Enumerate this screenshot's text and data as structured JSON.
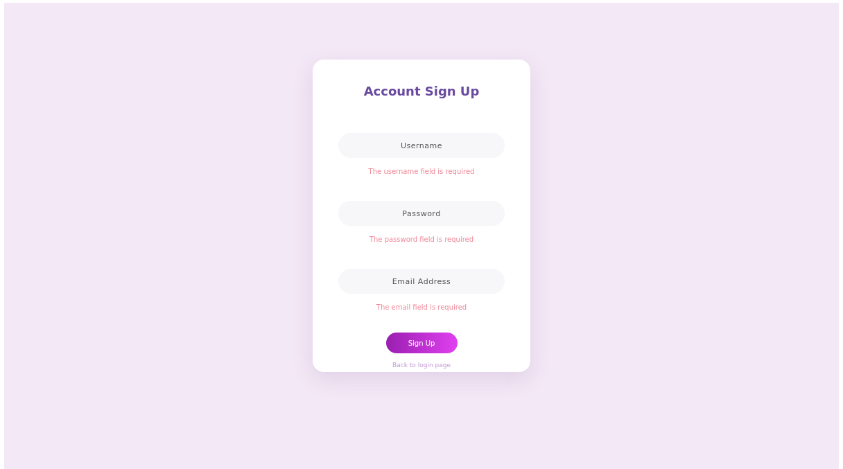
{
  "title": "Account Sign Up",
  "fields": [
    {
      "placeholder": "Username",
      "error": "The username field is required"
    },
    {
      "placeholder": "Password",
      "error": "The password field is required"
    },
    {
      "placeholder": "Email Address",
      "error": "The email field is required"
    }
  ],
  "submit": "Sign Up",
  "back_link": "Back to login page"
}
